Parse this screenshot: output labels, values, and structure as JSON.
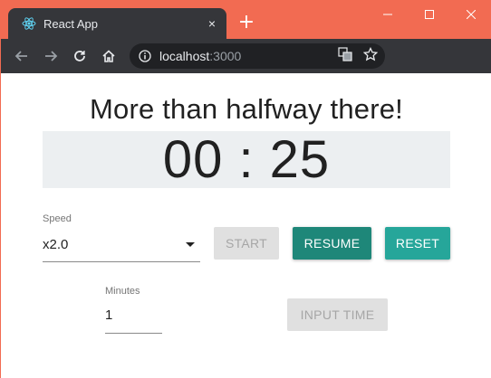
{
  "window": {
    "tab_title": "React App",
    "tab_close": "×",
    "new_tab": "+"
  },
  "toolbar": {
    "url_host": "localhost",
    "url_port": ":3000"
  },
  "page": {
    "headline": "More than halfway there!",
    "timer": "00 : 25",
    "speed": {
      "label": "Speed",
      "value": "x2.0"
    },
    "buttons": {
      "start": "START",
      "resume": "RESUME",
      "reset": "RESET",
      "input_time": "INPUT TIME"
    },
    "minutes": {
      "label": "Minutes",
      "value": "1"
    }
  },
  "colors": {
    "titlebar": "#f26b52",
    "resume": "#1e8779",
    "reset": "#26a69a",
    "timer_bg": "#eceff1"
  },
  "icons": [
    "react-icon",
    "close-icon",
    "plus-icon",
    "minimize-icon",
    "maximize-icon",
    "window-close-icon",
    "back-arrow-icon",
    "forward-arrow-icon",
    "reload-icon",
    "home-icon",
    "info-icon",
    "translate-icon",
    "star-icon",
    "extension-icon",
    "profile-icon",
    "menu-icon",
    "dropdown-arrow-icon"
  ]
}
